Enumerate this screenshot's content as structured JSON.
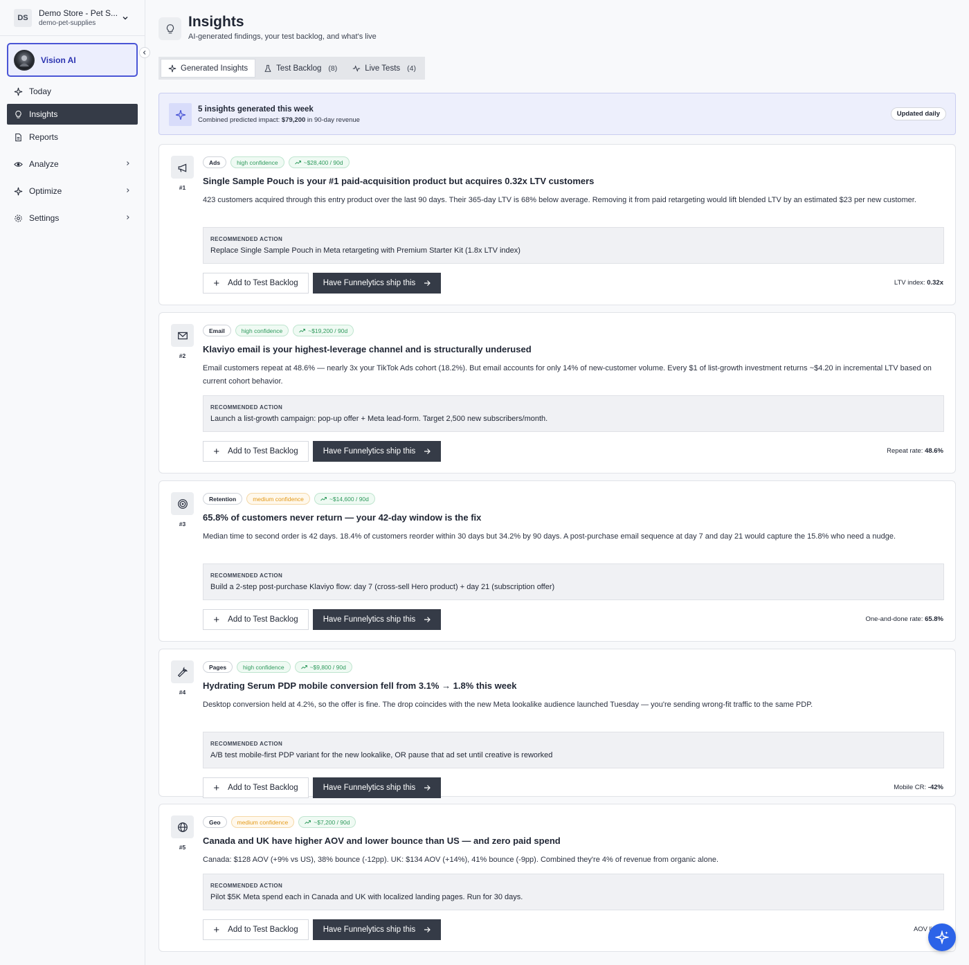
{
  "store": {
    "initials": "DS",
    "name": "Demo Store - Pet S...",
    "slug": "demo-pet-supplies"
  },
  "vision": {
    "label": "Vision AI"
  },
  "nav": [
    {
      "label": "Today",
      "icon": "sparkles-icon"
    },
    {
      "label": "Insights",
      "icon": "lightbulb-icon",
      "active": true
    },
    {
      "label": "Reports",
      "icon": "document-icon"
    },
    {
      "label": "Analyze",
      "icon": "eye-icon",
      "submenu": true
    },
    {
      "label": "Optimize",
      "icon": "sparkles-icon",
      "submenu": true
    },
    {
      "label": "Settings",
      "icon": "gear-icon",
      "submenu": true
    }
  ],
  "header": {
    "title": "Insights",
    "subtitle": "AI-generated findings, your test backlog, and what's live"
  },
  "tabs": [
    {
      "label": "Generated Insights",
      "count": "",
      "icon": "sparkles-icon",
      "active": true
    },
    {
      "label": "Test Backlog",
      "count": "(8)",
      "icon": "flask-icon"
    },
    {
      "label": "Live Tests",
      "count": "(4)",
      "icon": "activity-icon"
    }
  ],
  "banner": {
    "title": "5 insights generated this week",
    "sub_prefix": "Combined predicted impact: ",
    "sub_value": "$79,200",
    "sub_suffix": " in 90-day revenue",
    "pill": "Updated daily"
  },
  "common": {
    "rec_label": "RECOMMENDED ACTION",
    "add_label": "Add to Test Backlog",
    "ship_label": "Have Funnelytics ship this"
  },
  "insights": [
    {
      "num": "#1",
      "icon": "megaphone-icon",
      "category": "Ads",
      "confidence": "high confidence",
      "conf_level": "high",
      "revenue": "~$28,400 / 90d",
      "title": "Single Sample Pouch is your #1 paid-acquisition product but acquires 0.32x LTV customers",
      "body": "423 customers acquired through this entry product over the last 90 days. Their 365-day LTV is 68% below average. Removing it from paid retargeting would lift blended LTV by an estimated $23 per new customer.",
      "action": "Replace Single Sample Pouch in Meta retargeting with Premium Starter Kit (1.8x LTV index)",
      "metric_label": "LTV index: ",
      "metric_value": "0.32x"
    },
    {
      "num": "#2",
      "icon": "mail-icon",
      "category": "Email",
      "confidence": "high confidence",
      "conf_level": "high",
      "revenue": "~$19,200 / 90d",
      "title": "Klaviyo email is your highest-leverage channel and is structurally underused",
      "body": "Email customers repeat at 48.6% — nearly 3x your TikTok Ads cohort (18.2%). But email accounts for only 14% of new-customer volume. Every $1 of list-growth investment returns ~$4.20 in incremental LTV based on current cohort behavior.",
      "action": "Launch a list-growth campaign: pop-up offer + Meta lead-form. Target 2,500 new subscribers/month.",
      "metric_label": "Repeat rate: ",
      "metric_value": "48.6%"
    },
    {
      "num": "#3",
      "icon": "target-icon",
      "category": "Retention",
      "confidence": "medium confidence",
      "conf_level": "medium",
      "revenue": "~$14,600 / 90d",
      "title": "65.8% of customers never return — your 42-day window is the fix",
      "body": "Median time to second order is 42 days. 18.4% of customers reorder within 30 days but 34.2% by 90 days. A post-purchase email sequence at day 7 and day 21 would capture the 15.8% who need a nudge.",
      "action": "Build a 2-step post-purchase Klaviyo flow: day 7 (cross-sell Hero product) + day 21 (subscription offer)",
      "metric_label": "One-and-done rate: ",
      "metric_value": "65.8%"
    },
    {
      "num": "#4",
      "icon": "wrench-icon",
      "category": "Pages",
      "confidence": "high confidence",
      "conf_level": "high",
      "revenue": "~$9,800 / 90d",
      "title": "Hydrating Serum PDP mobile conversion fell from 3.1% → 1.8% this week",
      "body": "Desktop conversion held at 4.2%, so the offer is fine. The drop coincides with the new Meta lookalike audience launched Tuesday — you're sending wrong-fit traffic to the same PDP.",
      "action": "A/B test mobile-first PDP variant for the new lookalike, OR pause that ad set until creative is reworked",
      "metric_label": "Mobile CR: ",
      "metric_value": "-42%"
    },
    {
      "num": "#5",
      "icon": "globe-icon",
      "category": "Geo",
      "confidence": "medium confidence",
      "conf_level": "medium",
      "revenue": "~$7,200 / 90d",
      "title": "Canada and UK have higher AOV and lower bounce than US — and zero paid spend",
      "body": "Canada: $128 AOV (+9% vs US), 38% bounce (-12pp). UK: $134 AOV (+14%), 41% bounce (-9pp). Combined they're 4% of revenue from organic alone.",
      "action": "Pilot $5K Meta spend each in Canada and UK with localized landing pages. Run for 30 days.",
      "metric_label": "AOV lift: ",
      "metric_value": "+"
    }
  ],
  "colors": {
    "accent": "#4a55d6",
    "dark": "#353b47",
    "high": "#2f9a5d",
    "medium": "#e39a1a",
    "fab": "#2c63e8"
  }
}
